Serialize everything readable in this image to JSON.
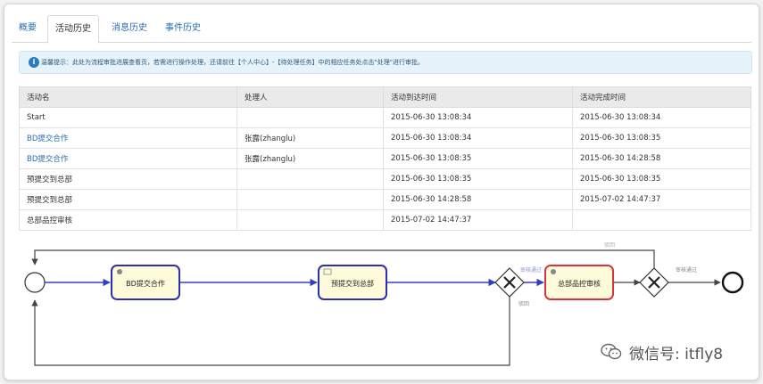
{
  "tabs": [
    {
      "label": "概要",
      "active": false
    },
    {
      "label": "活动历史",
      "active": true
    },
    {
      "label": "消息历史",
      "active": false
    },
    {
      "label": "事件历史",
      "active": false
    }
  ],
  "tip": {
    "icon": "info-icon",
    "text": "温馨提示：此处为流程审批进展查看页，若需进行操作处理，还请前往【个人中心】-【待处理任务】中的相应任务处点击\"处理\"进行审批。"
  },
  "table": {
    "headers": [
      "活动名",
      "处理人",
      "活动到达时间",
      "活动完成时间"
    ],
    "rows": [
      {
        "name": "Start",
        "handler": "",
        "arrived": "2015-06-30 13:08:34",
        "completed": "2015-06-30 13:08:34",
        "link": false
      },
      {
        "name": "BD提交合作",
        "handler": "张露(zhanglu)",
        "arrived": "2015-06-30 13:08:34",
        "completed": "2015-06-30 13:08:35",
        "link": true
      },
      {
        "name": "BD提交合作",
        "handler": "张露(zhanglu)",
        "arrived": "2015-06-30 13:08:35",
        "completed": "2015-06-30 14:28:58",
        "link": true
      },
      {
        "name": "预提交到总部",
        "handler": "",
        "arrived": "2015-06-30 13:08:35",
        "completed": "2015-06-30 13:08:35",
        "link": false
      },
      {
        "name": "预提交到总部",
        "handler": "",
        "arrived": "2015-06-30 14:28:58",
        "completed": "2015-07-02 14:47:37",
        "link": false
      },
      {
        "name": "总部品控审核",
        "handler": "",
        "arrived": "2015-07-02 14:47:37",
        "completed": "",
        "link": false
      }
    ]
  },
  "diagram": {
    "tasks": [
      "BD提交合作",
      "预提交到总部",
      "总部品控审核"
    ],
    "flow_labels": {
      "pass": "审核通过",
      "reject": "驳回",
      "approve": "审核通过",
      "back": "驳回"
    },
    "colors": {
      "active_border": "#d9333f",
      "done_border": "#2b2fb0",
      "task_fill": "#fdfbd9",
      "flow": "#3040c0"
    }
  },
  "watermark": {
    "text": "微信号: itfly8",
    "icon": "wechat-icon"
  }
}
